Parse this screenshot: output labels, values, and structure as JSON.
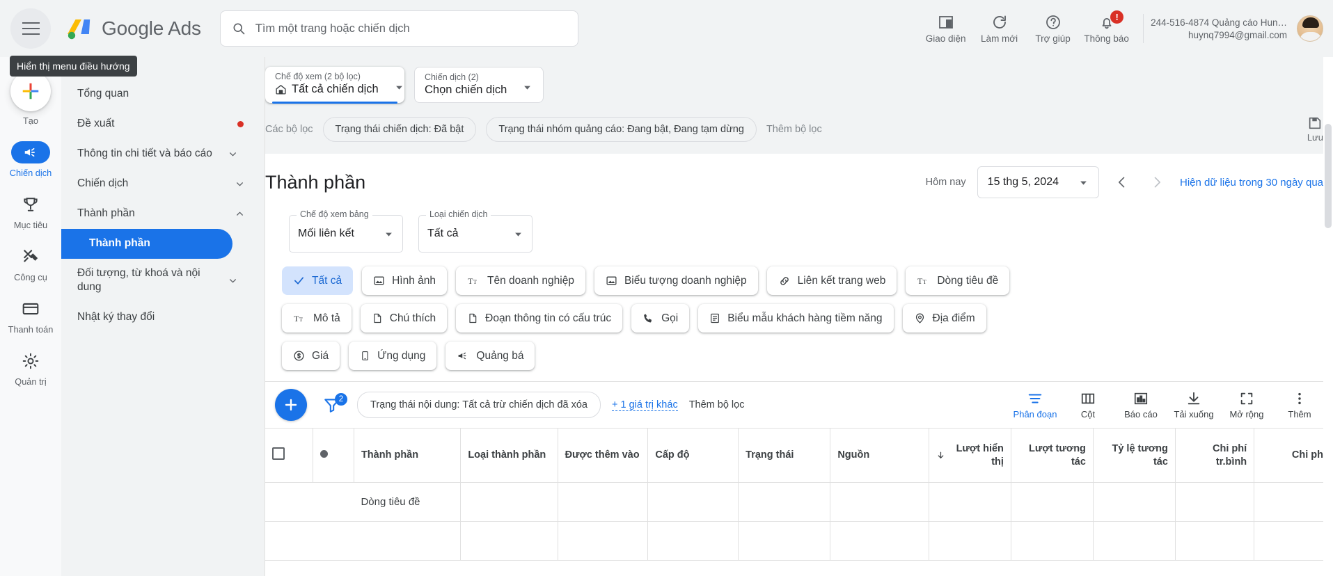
{
  "topbar": {
    "menu_tooltip": "Hiển thị menu điều hướng",
    "brand_primary": "Google",
    "brand_secondary": "Ads",
    "search_placeholder": "Tìm một trang hoặc chiến dịch",
    "actions": [
      {
        "icon": "appearance-icon",
        "label": "Giao diện"
      },
      {
        "icon": "refresh-icon",
        "label": "Làm mới"
      },
      {
        "icon": "help-icon",
        "label": "Trợ giúp"
      },
      {
        "icon": "notifications-bell-icon",
        "label": "Thông báo",
        "badge": "!"
      }
    ],
    "account": {
      "line1": "244-516-4874 Quảng cáo Hun…",
      "line2": "huynq7994@gmail.com"
    }
  },
  "rail": {
    "items": [
      {
        "icon": "plus-icon",
        "label": "Tạo",
        "active": false
      },
      {
        "icon": "campaigns-megaphone-icon",
        "label": "Chiến dịch",
        "active": true
      },
      {
        "icon": "goals-trophy-icon",
        "label": "Mục tiêu",
        "active": false
      },
      {
        "icon": "tools-icon",
        "label": "Công cụ",
        "active": false
      },
      {
        "icon": "billing-card-icon",
        "label": "Thanh toán",
        "active": false
      },
      {
        "icon": "admin-gear-icon",
        "label": "Quản trị",
        "active": false
      }
    ]
  },
  "subnav": {
    "items": [
      {
        "label": "Tổng quan",
        "dot": false,
        "chevron": "",
        "selected": false
      },
      {
        "label": "Đề xuất",
        "dot": true,
        "chevron": "",
        "selected": false
      },
      {
        "label": "Thông tin chi tiết và báo cáo",
        "dot": false,
        "chevron": "down",
        "selected": false
      },
      {
        "label": "Chiến dịch",
        "dot": false,
        "chevron": "down",
        "selected": false
      },
      {
        "label": "Thành phần",
        "dot": false,
        "chevron": "up",
        "selected": false
      },
      {
        "label": "Thành phần",
        "dot": false,
        "chevron": "",
        "selected": true
      },
      {
        "label": "Đối tượng, từ khoá và nội dung",
        "dot": false,
        "chevron": "down",
        "selected": false
      },
      {
        "label": "Nhật ký thay đổi",
        "dot": false,
        "chevron": "",
        "selected": false
      }
    ]
  },
  "selectors": {
    "view": {
      "label": "Chế độ xem (2 bộ lọc)",
      "value": "Tất cả chiến dịch",
      "icon": "home-icon"
    },
    "campaign": {
      "label": "Chiến dịch (2)",
      "value": "Chọn chiến dịch"
    }
  },
  "filters": {
    "label": "Các bộ lọc",
    "chips": [
      "Trạng thái chiến dịch: Đã bật",
      "Trạng thái nhóm quảng cáo: Đang bật, Đang tạm dừng"
    ],
    "add_label": "Thêm bộ lọc",
    "save": {
      "icon": "save-icon",
      "label": "Lưu"
    }
  },
  "page": {
    "title": "Thành phần",
    "date_label": "Hôm nay",
    "date_value": "15 thg 5, 2024",
    "prev_icon": "chevron-left-icon",
    "next_icon": "chevron-right-icon",
    "data_notice": "Hiện dữ liệu trong 30 ngày qua"
  },
  "view_modes": [
    {
      "legend": "Chế độ xem bảng",
      "value": "Mối liên kết"
    },
    {
      "legend": "Loại chiến dịch",
      "value": "Tất cả"
    }
  ],
  "asset_chips": [
    {
      "label": "Tất cả",
      "icon": "check-icon",
      "selected": true
    },
    {
      "label": "Hình ảnh",
      "icon": "image-icon",
      "selected": false
    },
    {
      "label": "Tên doanh nghiệp",
      "icon": "text-format-icon",
      "selected": false
    },
    {
      "label": "Biểu tượng doanh nghiệp",
      "icon": "image-icon",
      "selected": false
    },
    {
      "label": "Liên kết trang web",
      "icon": "link-icon",
      "selected": false
    },
    {
      "label": "Dòng tiêu đề",
      "icon": "text-format-icon",
      "selected": false
    },
    {
      "label": "Mô tả",
      "icon": "text-format-icon",
      "selected": false
    },
    {
      "label": "Chú thích",
      "icon": "document-icon",
      "selected": false
    },
    {
      "label": "Đoạn thông tin có cấu trúc",
      "icon": "document-icon",
      "selected": false
    },
    {
      "label": "Gọi",
      "icon": "phone-icon",
      "selected": false
    },
    {
      "label": "Biểu mẫu khách hàng tiềm năng",
      "icon": "form-icon",
      "selected": false
    },
    {
      "label": "Địa điểm",
      "icon": "location-pin-icon",
      "selected": false
    },
    {
      "label": "Giá",
      "icon": "price-tag-icon",
      "selected": false
    },
    {
      "label": "Ứng dụng",
      "icon": "mobile-app-icon",
      "selected": false
    },
    {
      "label": "Quảng bá",
      "icon": "promotion-icon",
      "selected": false
    }
  ],
  "table_toolbar": {
    "add_icon": "plus-icon",
    "filter_icon": "filter-funnel-icon",
    "filter_count": "2",
    "status_chip": "Trạng thái nội dung: Tất cả trừ chiến dịch đã xóa",
    "more_values": "+ 1 giá trị khác",
    "add_filter": "Thêm bộ lọc",
    "tools": [
      {
        "icon": "segment-icon",
        "label": "Phân đoạn",
        "accent": true
      },
      {
        "icon": "columns-icon",
        "label": "Cột",
        "accent": false
      },
      {
        "icon": "reports-icon",
        "label": "Báo cáo",
        "accent": false
      },
      {
        "icon": "download-icon",
        "label": "Tải xuống",
        "accent": false
      },
      {
        "icon": "expand-icon",
        "label": "Mở rộng",
        "accent": false
      },
      {
        "icon": "more-vert-icon",
        "label": "Thêm",
        "accent": false
      }
    ]
  },
  "table": {
    "columns": [
      {
        "key": "checkbox",
        "label": "",
        "num": false
      },
      {
        "key": "status",
        "label": "",
        "num": false
      },
      {
        "key": "asset",
        "label": "Thành phần",
        "num": false
      },
      {
        "key": "asset_type",
        "label": "Loại thành phần",
        "num": false
      },
      {
        "key": "added_to",
        "label": "Được thêm vào",
        "num": false
      },
      {
        "key": "level",
        "label": "Cấp độ",
        "num": false
      },
      {
        "key": "state",
        "label": "Trạng thái",
        "num": false
      },
      {
        "key": "source",
        "label": "Nguồn",
        "num": false
      },
      {
        "key": "impressions",
        "label": "Lượt hiển thị",
        "num": true,
        "sorted": true
      },
      {
        "key": "interactions",
        "label": "Lượt tương tác",
        "num": true
      },
      {
        "key": "interaction_rate",
        "label": "Tỷ lệ tương tác",
        "num": true
      },
      {
        "key": "avg_cost",
        "label": "Chi phí tr.bình",
        "num": true
      },
      {
        "key": "cost",
        "label": "Chi phí",
        "num": true
      }
    ],
    "rows": [
      {
        "asset": "Dòng tiêu đề",
        "group": true
      }
    ]
  }
}
